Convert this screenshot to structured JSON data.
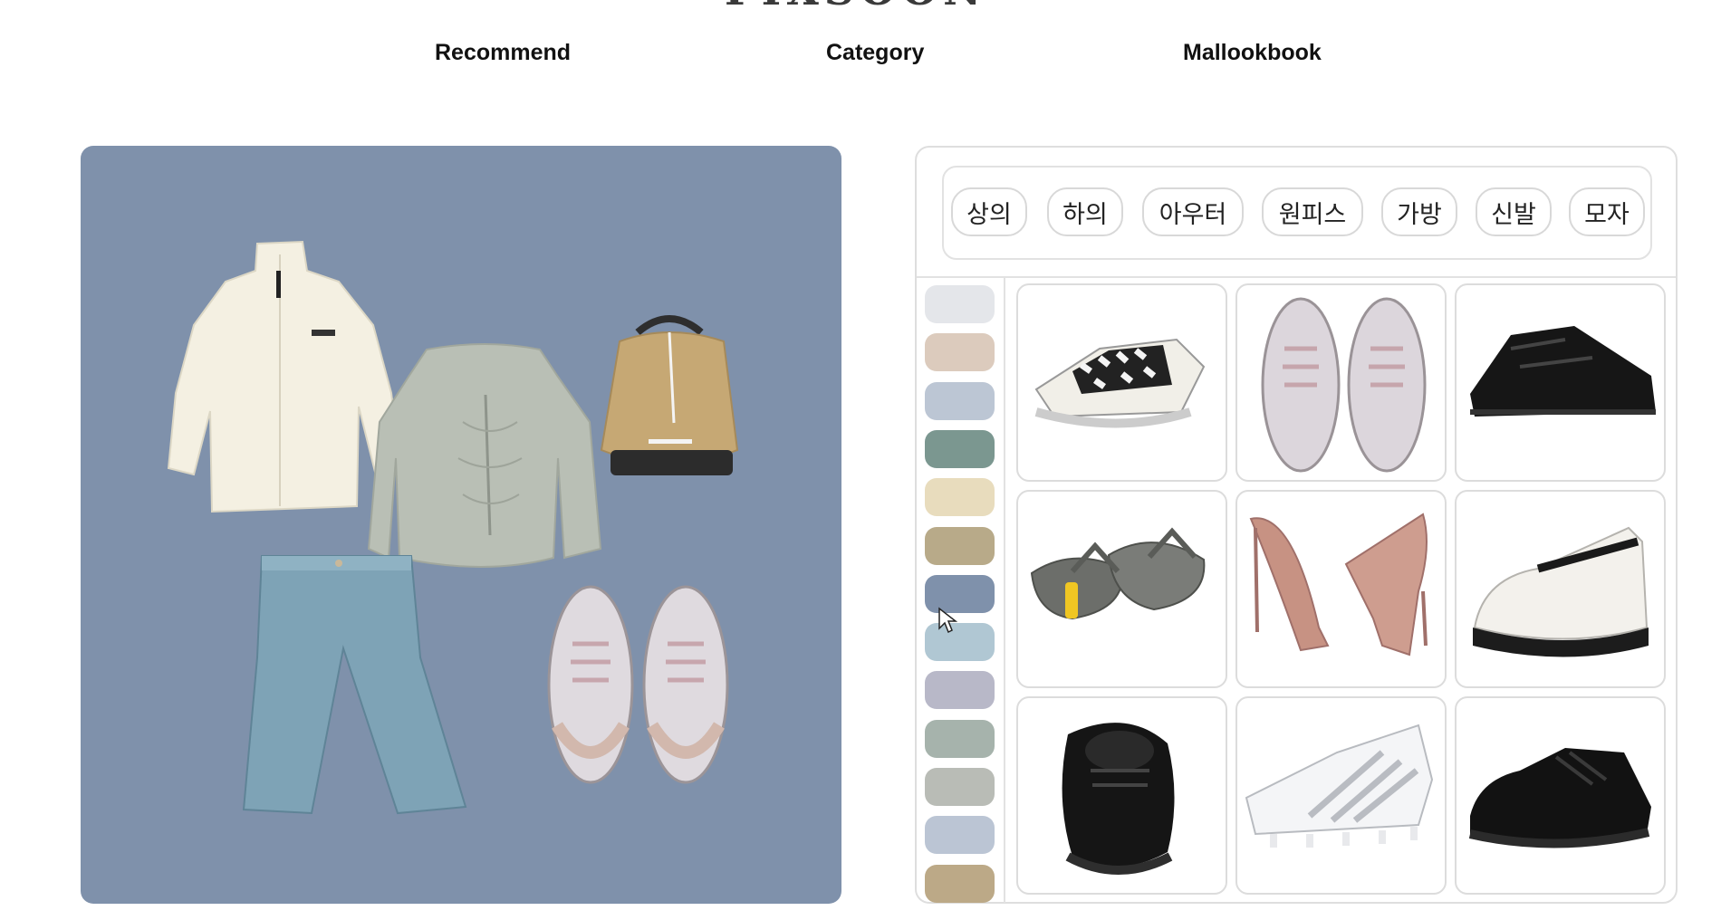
{
  "nav": {
    "items": [
      {
        "label": "Recommend"
      },
      {
        "label": "Category"
      },
      {
        "label": "Mallookbook"
      }
    ]
  },
  "outfit": {
    "background_color": "#7f91ab",
    "items": [
      "fleece-jacket",
      "gray-shirred-hoodie",
      "beige-backpack",
      "light-wash-jeans",
      "gray-pink-sneakers"
    ]
  },
  "categories": [
    {
      "label": "상의"
    },
    {
      "label": "하의"
    },
    {
      "label": "아우터"
    },
    {
      "label": "원피스"
    },
    {
      "label": "가방"
    },
    {
      "label": "신발"
    },
    {
      "label": "모자"
    }
  ],
  "color_swatches": [
    "#e4e6ea",
    "#dccbbd",
    "#bcc6d4",
    "#7b9790",
    "#e8dcbd",
    "#b8aa89",
    "#7f91ab",
    "#b0c7d3",
    "#b8b8c8",
    "#a6b3ac",
    "#b9bcb6",
    "#bbc5d4",
    "#bca987"
  ],
  "products": [
    {
      "name": "checkered-slip-on"
    },
    {
      "name": "gray-pink-sneakers"
    },
    {
      "name": "black-trail-sneaker"
    },
    {
      "name": "gray-flip-flops"
    },
    {
      "name": "nude-pumps"
    },
    {
      "name": "white-mary-jane"
    },
    {
      "name": "black-lace-up-shoe"
    },
    {
      "name": "white-soccer-cleats"
    },
    {
      "name": "black-derby-shoe"
    }
  ]
}
